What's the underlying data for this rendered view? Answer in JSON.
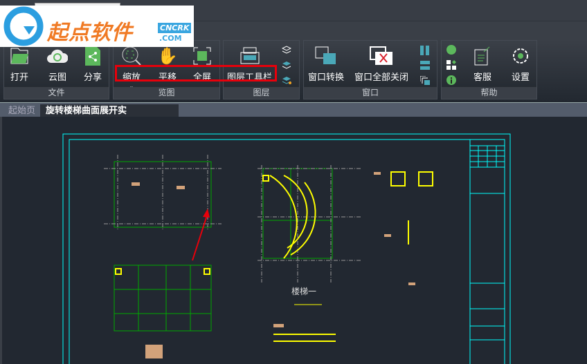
{
  "logo": {
    "text": "起点软件",
    "badge": "CNCRK",
    "domain": ".COM"
  },
  "ribbon": {
    "panels": [
      {
        "label": "文件",
        "buttons": [
          "打开",
          "云图",
          "分享"
        ]
      },
      {
        "label": "览图",
        "buttons": [
          "缩放",
          "平移",
          "全屏"
        ]
      },
      {
        "label": "图层",
        "buttons": [
          "图层工具栏"
        ]
      },
      {
        "label": "窗口",
        "buttons": [
          "窗口转换",
          "窗口全部关闭"
        ]
      },
      {
        "label": "帮助",
        "buttons": [
          "客服",
          "设置"
        ]
      }
    ]
  },
  "tabs": [
    {
      "label": "起始页"
    },
    {
      "label": "旋转楼梯曲面展开实例.dwg",
      "close": "×"
    }
  ],
  "drawing": {
    "title": "楼梯一"
  },
  "colors": {
    "accent_cyan": "#00ffff",
    "highlight": "#e8000b",
    "icon_teal": "#4aa8b8",
    "icon_green": "#5cb85c"
  }
}
